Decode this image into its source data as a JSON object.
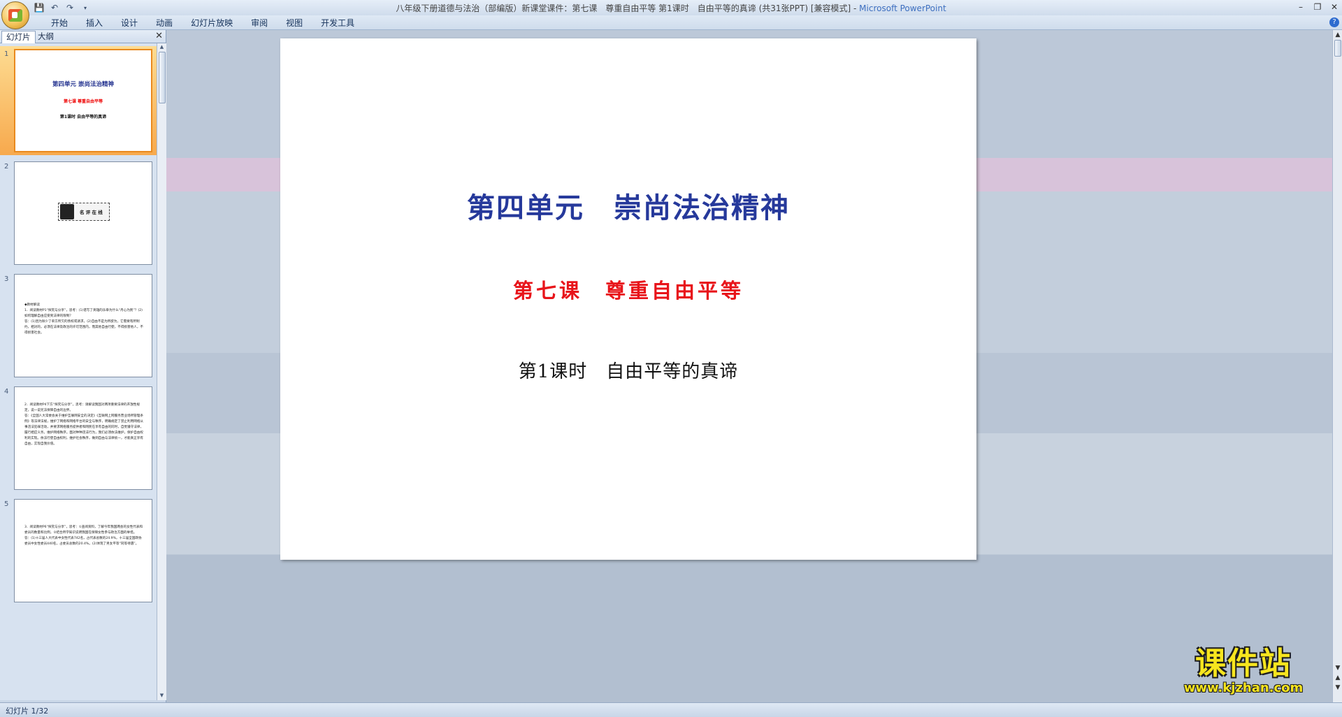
{
  "window": {
    "title": "八年级下册道德与法治（部编版）新课堂课件：第七课　尊重自由平等 第1课时　自由平等的真谛 (共31张PPT) [兼容模式] -",
    "app_name": "Microsoft PowerPoint"
  },
  "ribbon": {
    "tabs": [
      "开始",
      "插入",
      "设计",
      "动画",
      "幻灯片放映",
      "审阅",
      "视图",
      "开发工具"
    ]
  },
  "panel": {
    "tab_slides": "幻灯片",
    "tab_outline": "大纲",
    "close": "✕"
  },
  "thumbnails": [
    {
      "num": "1",
      "title": "第四单元  崇尚法治精神",
      "subtitle": "第七课    尊重自由平等",
      "lesson": "第1课时  自由平等的真谛"
    },
    {
      "num": "2",
      "badge": "名 评 在 线"
    },
    {
      "num": "3",
      "text": "◆教材解读\n1．阅读教材P1“探究与分享”，思考：(1)谱写了英雄的乐章为什么“丹心为民”？(2)如何理解自由应受到法律的限制？\n答：(1)因为除少了单方所欠的债权或请求，(2)自由不是为所欲为，它需要有所制约，相对的，必须在法律及政治的许可范围内，而其他自由行使，不得损害他人，不得损害社会。"
    },
    {
      "num": "4",
      "text": "2．阅读教材P4下方“探究与分享”，思考：请解读我国对两项重要法律的开放性规定，说一说宪法保障自由的边界。\n答：《全国人大常委会关于维护互联网安全的决定》《互联网上网服务营业场所管理条例》等法律法规，维护了网络和网络平台的安全与秩序，明确规定了禁止利用网络从事违法犯罪活动，并要求网络服务提供者和网民在享有自由的同时，自觉遵守法律，履行相应义务，维护网络秩序。面对种种违法行为，我们必须依法维护，保护自由权利的实现。依法行使自由权利，维护社会秩序，做到自由与法律统一，才能真正享有自由，实现自我价值。"
    },
    {
      "num": "5",
      "text": "3．阅读教材P6“探究与分享”，思考：①查阅资料，了解今年我国两会的女性代表和委员的数量和比例，②结合所学知识说明我国在保障女性参与政治方面的举措。\n答：(1)十三届人大代表中女性代表742名，占代表总数的24.9%，十三届全国政协委员中女性委员440名，占委员总数的20.4%。(2)体现了男女平等“同等待遇”。"
    }
  ],
  "slide": {
    "title": "第四单元　崇尚法治精神",
    "subtitle": "第七课　尊重自由平等",
    "lesson": "第1课时　自由平等的真谛"
  },
  "watermark": {
    "cn": "课件站",
    "url": "www.kjzhan.com"
  },
  "status": {
    "slide_counter": "幻灯片 1/32"
  },
  "colors": {
    "title_blue": "#26399b",
    "subtitle_red": "#e8141a",
    "selection_orange": "#f7a94d",
    "watermark_yellow": "#f7e51e"
  }
}
